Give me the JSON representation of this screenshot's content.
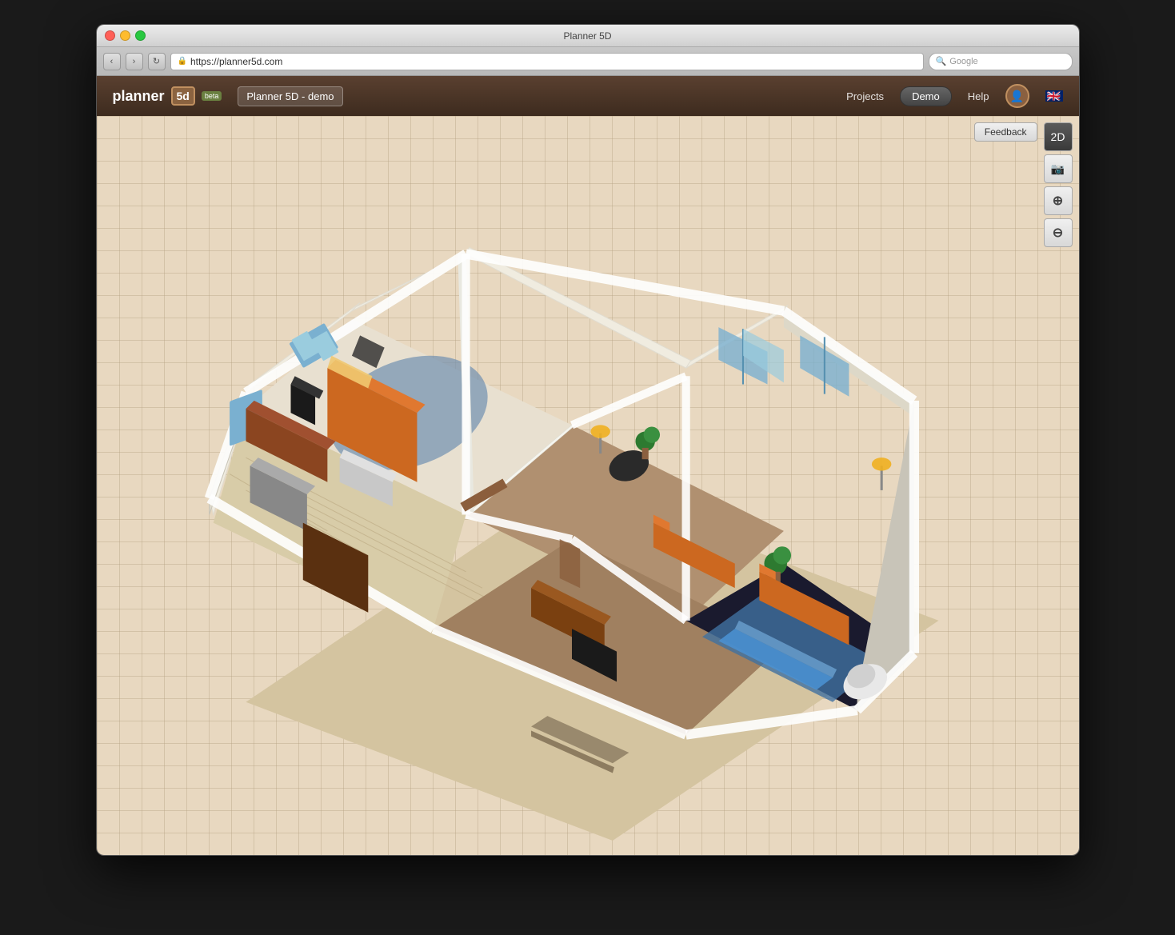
{
  "window": {
    "title": "Planner 5D",
    "controls": {
      "close": "close",
      "minimize": "minimize",
      "maximize": "maximize"
    }
  },
  "browser": {
    "url": "https://planner5d.com",
    "url_icon": "🔒",
    "search_placeholder": "Google",
    "back_label": "‹",
    "forward_label": "›",
    "reload_label": "↻"
  },
  "header": {
    "logo_text": "planner",
    "logo_5d": "5d",
    "beta_label": "beta",
    "project_name": "Planner 5D - demo",
    "nav": {
      "projects_label": "Projects",
      "demo_label": "Demo",
      "help_label": "Help"
    },
    "flag": "🇬🇧"
  },
  "toolbar": {
    "feedback_label": "Feedback",
    "view_2d_label": "2D",
    "screenshot_label": "📷",
    "zoom_in_label": "⊕",
    "zoom_out_label": "⊖"
  },
  "canvas": {
    "background_color": "#e8d8c0",
    "grid_color": "rgba(180,160,130,0.4)"
  }
}
